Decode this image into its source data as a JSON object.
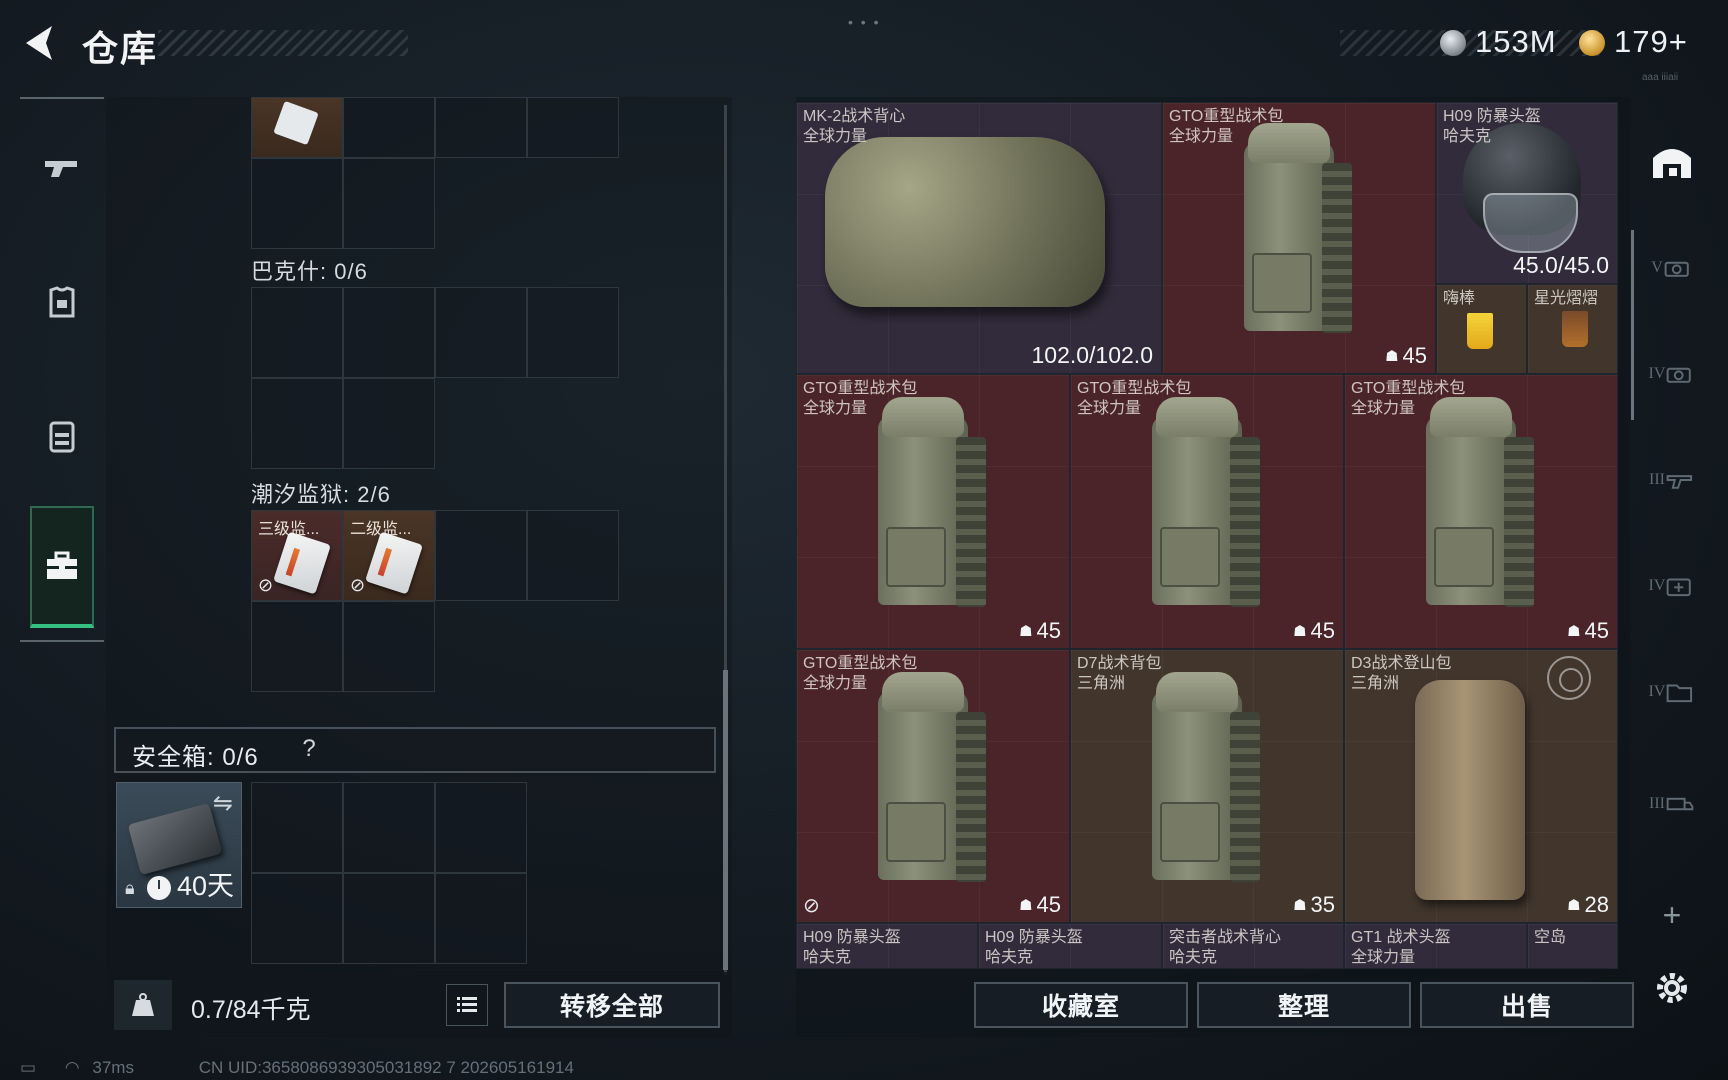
{
  "header": {
    "title": "仓库",
    "currency_silver": "153M",
    "currency_gold": "179+",
    "drag_handle": "• • •",
    "version_hint": "aaa iiiaii"
  },
  "left_nav": {
    "items": [
      {
        "name": "weapons",
        "icon": "pistol-icon"
      },
      {
        "name": "armor",
        "icon": "armor-icon"
      },
      {
        "name": "backpack",
        "icon": "backpack-icon"
      },
      {
        "name": "toolbox",
        "icon": "toolbox-icon",
        "active": true
      }
    ]
  },
  "containers": {
    "bakshi_label": "巴克什: 0/6",
    "tidal_prison_label": "潮汐监狱: 2/6",
    "tidal_items": [
      {
        "label": "三级监..."
      },
      {
        "label": "二级监..."
      }
    ],
    "safebox_label": "安全箱: 0/6",
    "safebox_help": "?",
    "safebox_days": "40天"
  },
  "footer_left": {
    "weight": "0.7/84千克",
    "transfer_all": "转移全部"
  },
  "stash": {
    "tiles": [
      {
        "name": "MK-2战术背心",
        "sub": "全球力量",
        "value": "102.0/102.0"
      },
      {
        "name": "GTO重型战术包",
        "sub": "全球力量",
        "badge": "45"
      },
      {
        "name": "H09 防暴头盔",
        "sub": "哈夫克",
        "value": "45.0/45.0"
      },
      {
        "name": "嗨棒",
        "sub": ""
      },
      {
        "name": "星光熠熠",
        "sub": ""
      },
      {
        "name": "GTO重型战术包",
        "sub": "全球力量",
        "badge": "45"
      },
      {
        "name": "GTO重型战术包",
        "sub": "全球力量",
        "badge": "45"
      },
      {
        "name": "GTO重型战术包",
        "sub": "全球力量",
        "badge": "45"
      },
      {
        "name": "GTO重型战术包",
        "sub": "全球力量",
        "badge": "45"
      },
      {
        "name": "D7战术背包",
        "sub": "三角洲",
        "badge": "35"
      },
      {
        "name": "D3战术登山包",
        "sub": "三角洲",
        "badge": "28"
      },
      {
        "name": "H09 防暴头盔",
        "sub": "哈夫克"
      },
      {
        "name": "H09 防暴头盔",
        "sub": "哈夫克"
      },
      {
        "name": "突击者战术背心",
        "sub": "哈夫克"
      },
      {
        "name": "GT1 战术头盔",
        "sub": "全球力量"
      },
      {
        "name": "空岛",
        "sub": ""
      }
    ]
  },
  "right_nav": {
    "tiers": [
      "V",
      "IV",
      "III",
      "IV",
      "IV",
      "III"
    ],
    "add": "+"
  },
  "footer_right": {
    "collection": "收藏室",
    "organize": "整理",
    "sell": "出售"
  },
  "status": {
    "ping": "37ms",
    "uid": "CN UID:3658086939305031892 7  202605161914"
  },
  "colors": {
    "tile_red": "#4a2428",
    "tile_purple": "#312b3b",
    "tile_brown": "#41352c",
    "accent_green": "#35c281"
  }
}
